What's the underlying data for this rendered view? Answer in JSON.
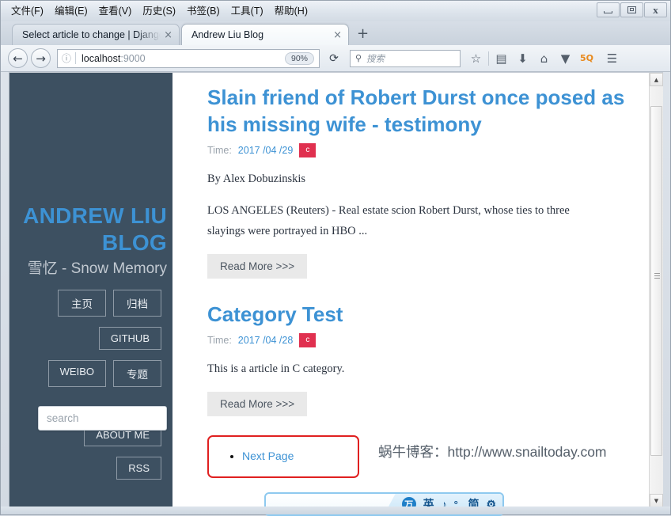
{
  "window": {
    "menu": [
      {
        "label": "文件(F)",
        "accel": "F"
      },
      {
        "label": "编辑(E)",
        "accel": "E"
      },
      {
        "label": "查看(V)",
        "accel": "V"
      },
      {
        "label": "历史(S)",
        "accel": "S"
      },
      {
        "label": "书签(B)",
        "accel": "B"
      },
      {
        "label": "工具(T)",
        "accel": "T"
      },
      {
        "label": "帮助(H)",
        "accel": "H"
      }
    ],
    "controls": {
      "minimize": "minimize-button",
      "maximize": "maximize-button",
      "close": "close-button"
    }
  },
  "tabs": {
    "items": [
      {
        "title": "Select article to change | Django",
        "active": false,
        "close": "×"
      },
      {
        "title": "Andrew Liu Blog",
        "active": true,
        "close": "×"
      }
    ],
    "new_tab": "+"
  },
  "toolbar": {
    "back": "←",
    "forward": "→",
    "identity_icon": "ⓘ",
    "url_host": "localhost",
    "url_port": ":9000",
    "zoom_level": "90%",
    "reload": "⟳",
    "search_placeholder": "搜索",
    "search_icon": "⚲",
    "icons": [
      {
        "name": "bookmark-star-icon",
        "glyph": "☆"
      },
      {
        "name": "reader-list-icon",
        "glyph": "▤"
      },
      {
        "name": "downloads-icon",
        "glyph": "⬇"
      },
      {
        "name": "home-icon",
        "glyph": "⌂"
      },
      {
        "name": "pocket-icon",
        "glyph": "▼"
      },
      {
        "name": "addon-5q-icon",
        "glyph": "5Q"
      },
      {
        "name": "hamburger-menu-icon",
        "glyph": "☰"
      }
    ]
  },
  "sidebar": {
    "title": "ANDREW LIU BLOG",
    "subtitle": "雪忆 - Snow Memory",
    "nav_rows": [
      [
        {
          "label": "主页",
          "cn": true
        },
        {
          "label": "归档",
          "cn": true
        }
      ],
      [
        {
          "label": "GITHUB",
          "cn": false
        }
      ],
      [
        {
          "label": "WEIBO",
          "cn": false
        },
        {
          "label": "专题",
          "cn": true
        }
      ],
      [
        {
          "label": "ABOUT ME",
          "cn": false
        }
      ],
      [
        {
          "label": "RSS",
          "cn": false
        }
      ]
    ],
    "search_placeholder": "search"
  },
  "content": {
    "posts": [
      {
        "title": "Slain friend of Robert Durst once posed as his missing wife - testimony",
        "time_label": "Time:",
        "date": "2017 /04 /29",
        "category": "c",
        "body": [
          "By Alex Dobuzinskis",
          "LOS ANGELES (Reuters) - Real estate scion Robert Durst, whose ties to three slayings were portrayed in HBO ..."
        ],
        "read_more": "Read More >>>"
      },
      {
        "title": "Category Test",
        "time_label": "Time:",
        "date": "2017 /04 /28",
        "category": "c",
        "body": [
          "This is a article in C category."
        ],
        "read_more": "Read More >>>"
      }
    ],
    "watermark": "蜗牛博客：http://www.snailtoday.com",
    "pager": {
      "next_label": "Next Page"
    }
  },
  "ime": {
    "logo": "万",
    "items": [
      {
        "name": "language-mode",
        "glyph": "英"
      },
      {
        "name": "moon-tone",
        "glyph": "♪"
      },
      {
        "name": "punctuation-mode",
        "glyph": "°,"
      },
      {
        "name": "simplified-chinese",
        "glyph": "简"
      },
      {
        "name": "ime-settings-gear-icon",
        "glyph": "⚙"
      }
    ]
  },
  "colors": {
    "sidebar_bg": "#3d5061",
    "accent_blue": "#3d92d4",
    "badge_red": "#e0304f",
    "pager_border": "#e02020"
  }
}
